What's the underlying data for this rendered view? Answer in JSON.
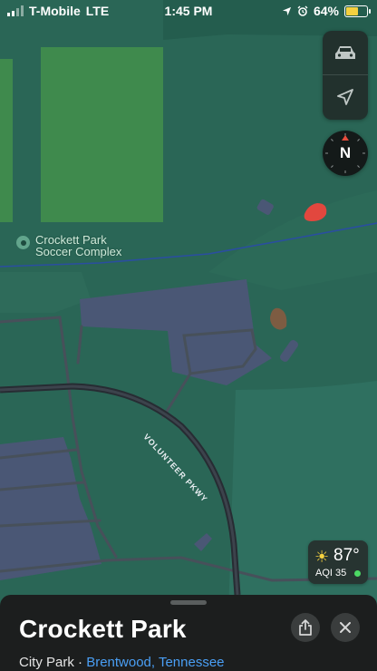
{
  "status_bar": {
    "carrier": "T-Mobile",
    "network": "LTE",
    "time": "1:45 PM",
    "battery": "64%",
    "battery_level": 0.64,
    "icons": [
      "signal-bars-icon",
      "location-arrow-icon",
      "alarm-clock-icon",
      "battery-icon"
    ]
  },
  "map_controls": {
    "icons": [
      "car-icon",
      "location-arrow-icon"
    ],
    "compass_label": "N"
  },
  "poi": {
    "label_line1": "Crockett Park",
    "label_line2": "Soccer Complex"
  },
  "road_label": "VOLUNTEER PKWY",
  "weather": {
    "temperature": "87°",
    "aqi": "AQI 35",
    "icon": "sun-icon",
    "aqi_color": "#4cd964"
  },
  "place_card": {
    "title": "Crockett Park",
    "category": "City Park",
    "separator": " · ",
    "location": "Brentwood, Tennessee",
    "icons": [
      "share-icon",
      "close-icon"
    ]
  },
  "colors": {
    "map_background": "#2a6656",
    "field": "#3f8a4d",
    "building": "#4a5775",
    "link": "#4a9ff5"
  }
}
